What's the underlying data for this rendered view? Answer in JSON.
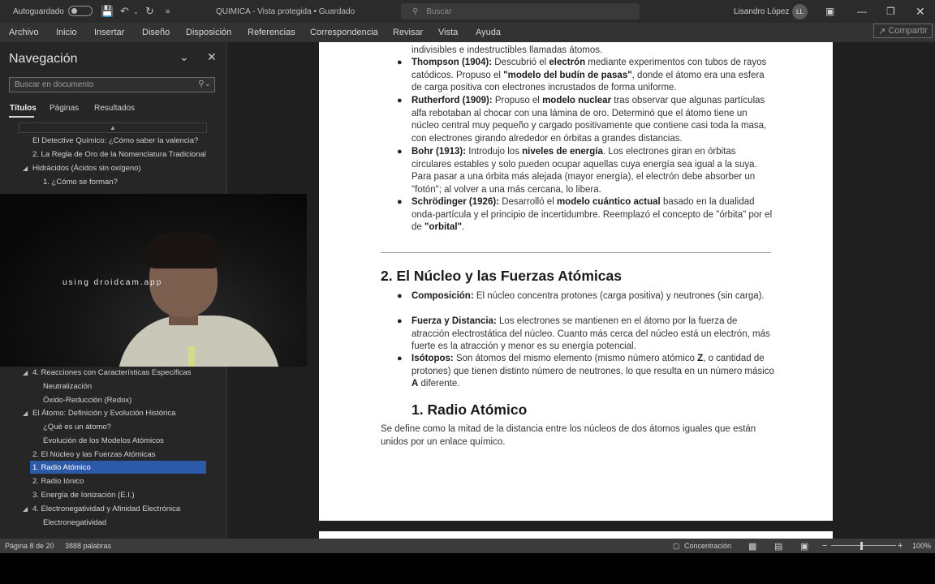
{
  "titlebar": {
    "autosave_label": "Autoguardado",
    "title": "QUIMICA  -  Vista protegida  •  Guardado",
    "search_placeholder": "Buscar",
    "user_name": "Lisandro López",
    "user_initials": "LL"
  },
  "ribbon": {
    "tabs": [
      "Archivo",
      "Inicio",
      "Insertar",
      "Diseño",
      "Disposición",
      "Referencias",
      "Correspondencia",
      "Revisar",
      "Vista",
      "Ayuda"
    ],
    "share_label": "Compartir"
  },
  "nav": {
    "title": "Navegación",
    "search_placeholder": "Buscar en documento",
    "tabs": [
      "Títulos",
      "Páginas",
      "Resultados"
    ],
    "items": [
      "El Detective Químico: ¿Cómo saber la valencia?",
      "2. La Regla de Oro de la Nomenclatura Tradicional",
      "Hidrácidos (Ácidos sin oxígeno)",
      "1. ¿Cómo se forman?",
      "4. Reacciones con Características Específicas",
      "Neutralización",
      "Óxido-Reducción (Redox)",
      "El Átomo: Definición y Evolución Histórica",
      "¿Qué es un átomo?",
      "Evolución de los Modelos Atómicos",
      "2. El Núcleo y las Fuerzas Atómicas",
      "1. Radio Atómico",
      "2. Radio Iónico",
      "3. Energía de Ionización (E.I.)",
      "4. Electronegatividad y Afinidad Electrónica",
      "Electronegatividad"
    ]
  },
  "webcam": {
    "watermark": "using droidcam.app"
  },
  "document": {
    "top_line": "indivisibles e indestructibles llamadas átomos.",
    "thompson": {
      "lead": "Thompson (1904):",
      "t1": " Descubrió el ",
      "b1": "electrón",
      "t2": " mediante experimentos con tubos de rayos catódicos. Propuso el ",
      "b2": "\"modelo del budín de pasas\"",
      "t3": ", donde el átomo era una esfera de carga positiva con electrones incrustados de forma uniforme."
    },
    "rutherford": {
      "lead": "Rutherford (1909):",
      "t1": " Propuso el ",
      "b1": "modelo nuclear",
      "t2": " tras observar que algunas partículas alfa rebotaban al chocar con una lámina de oro. Determinó que el átomo tiene un núcleo central muy pequeño y cargado positivamente que contiene casi toda la masa, con electrones girando alrededor en órbitas a grandes distancias."
    },
    "bohr": {
      "lead": "Bohr (1913):",
      "t1": " Introdujo los ",
      "b1": "niveles de energía",
      "t2": ". Los electrones giran en órbitas circulares estables y solo pueden ocupar aquellas cuya energía sea igual a la suya. Para pasar a una órbita más alejada (mayor energía), el electrón debe absorber un \"fotón\"; al volver a una más cercana, lo libera."
    },
    "schrodinger": {
      "lead": "Schrödinger (1926):",
      "t1": " Desarrolló el ",
      "b1": "modelo cuántico actual",
      "t2": " basado en la dualidad onda-partícula y el principio de incertidumbre. Reemplazó el concepto de \"órbita\" por el de ",
      "b2": "\"orbital\"",
      "t3": "."
    },
    "heading2": "2. El Núcleo y las Fuerzas Atómicas",
    "composicion": {
      "lead": "Composición:",
      "t1": " El núcleo concentra protones (carga positiva) y neutrones (sin carga)."
    },
    "fuerza": {
      "lead": "Fuerza y Distancia:",
      "t1": " Los electrones se mantienen en el átomo por la fuerza de atracción electrostática del núcleo. Cuanto más cerca del núcleo está un electrón, más fuerte es la atracción y menor es su energía potencial."
    },
    "isotopos": {
      "lead": "Isótopos:",
      "t1": " Son átomos del mismo elemento (mismo número atómico ",
      "b1": "Z",
      "t2": ", o cantidad de protones) que tienen distinto número de neutrones, lo que resulta en un número másico ",
      "b2": "A",
      "t3": " diferente."
    },
    "heading3": "1. Radio Atómico",
    "radio_text": "Se define como la mitad de la distancia entre los núcleos de dos átomos iguales que están unidos por un enlace químico."
  },
  "status": {
    "page": "Página 8 de 20",
    "words": "3888 palabras",
    "focus": "Concentración",
    "zoom": "100%"
  }
}
